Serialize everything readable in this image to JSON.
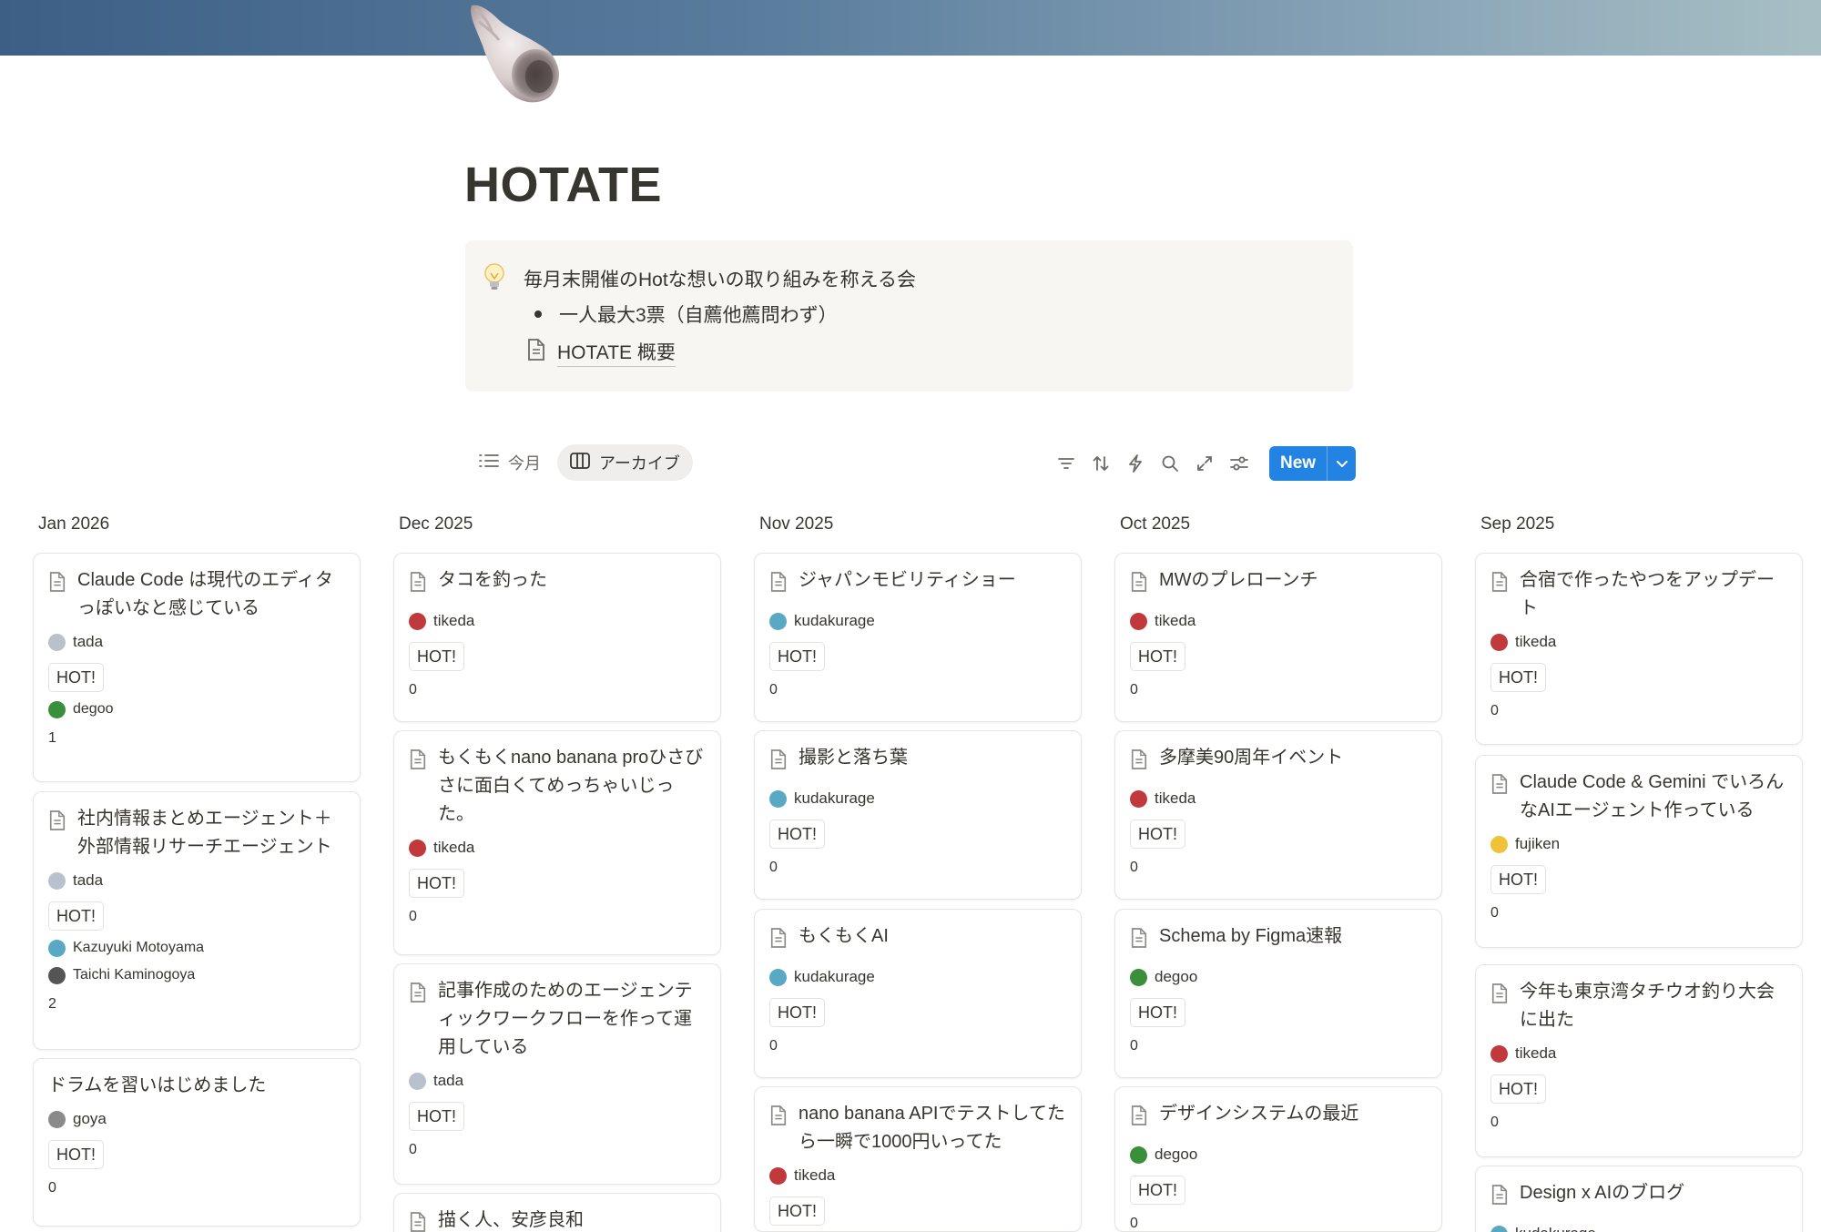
{
  "page": {
    "title": "HOTATE",
    "icon": "shell-icon"
  },
  "callout": {
    "icon": "lightbulb-icon",
    "text": "毎月末開催のHotな想いの取り組みを称える会",
    "bullet": "一人最大3票（自薦他薦問わず）",
    "link_icon": "page-icon",
    "link": "HOTATE 概要"
  },
  "views": [
    {
      "label": "今月",
      "icon": "list-icon",
      "active": false
    },
    {
      "label": "アーカイブ",
      "icon": "board-icon",
      "active": true
    }
  ],
  "toolbar": {
    "icons": [
      "filter-icon",
      "sort-icon",
      "automation-icon",
      "search-icon",
      "expand-icon",
      "settings-icon"
    ],
    "new_label": "New"
  },
  "columns": [
    {
      "title": "Jan 2026",
      "cards": [
        {
          "title": "Claude Code は現代のエディタっぽいなと感じている",
          "doc_icon": true,
          "author": "tada",
          "tag": "HOT!",
          "voters": [
            "degoo"
          ],
          "count": "1"
        },
        {
          "title": "社内情報まとめエージェント＋外部情報リサーチエージェント",
          "doc_icon": true,
          "author": "tada",
          "tag": "HOT!",
          "voters": [
            "Kazuyuki Motoyama",
            "Taichi Kaminogoya"
          ],
          "count": "2"
        },
        {
          "title": "ドラムを習いはじめました",
          "doc_icon": false,
          "author": "goya",
          "tag": "HOT!",
          "voters": [],
          "count": "0"
        }
      ]
    },
    {
      "title": "Dec 2025",
      "cards": [
        {
          "title": "タコを釣った",
          "doc_icon": true,
          "author": "tikeda",
          "tag": "HOT!",
          "voters": [],
          "count": "0"
        },
        {
          "title": "もくもくnano banana proひさびさに面白くてめっちゃいじった。",
          "doc_icon": true,
          "author": "tikeda",
          "tag": "HOT!",
          "voters": [],
          "count": "0"
        },
        {
          "title": "記事作成のためのエージェンティックワークフローを作って運用している",
          "doc_icon": true,
          "author": "tada",
          "tag": "HOT!",
          "voters": [],
          "count": "0"
        },
        {
          "title": "描く人、安彦良和",
          "doc_icon": true,
          "author": "",
          "tag": "",
          "voters": [],
          "count": ""
        }
      ]
    },
    {
      "title": "Nov 2025",
      "cards": [
        {
          "title": "ジャパンモビリティショー",
          "doc_icon": true,
          "author": "kudakurage",
          "tag": "HOT!",
          "voters": [],
          "count": "0"
        },
        {
          "title": "撮影と落ち葉",
          "doc_icon": true,
          "author": "kudakurage",
          "tag": "HOT!",
          "voters": [],
          "count": "0"
        },
        {
          "title": "もくもくAI",
          "doc_icon": true,
          "author": "kudakurage",
          "tag": "HOT!",
          "voters": [],
          "count": "0"
        },
        {
          "title": "nano banana APIでテストしてたら一瞬で1000円いってた",
          "doc_icon": true,
          "author": "tikeda",
          "tag": "HOT!",
          "voters": [],
          "count": ""
        }
      ]
    },
    {
      "title": "Oct 2025",
      "cards": [
        {
          "title": "MWのプレローンチ",
          "doc_icon": true,
          "author": "tikeda",
          "tag": "HOT!",
          "voters": [],
          "count": "0"
        },
        {
          "title": "多摩美90周年イベント",
          "doc_icon": true,
          "author": "tikeda",
          "tag": "HOT!",
          "voters": [],
          "count": "0"
        },
        {
          "title": "Schema by Figma速報",
          "doc_icon": true,
          "author": "degoo",
          "tag": "HOT!",
          "voters": [],
          "count": "0"
        },
        {
          "title": "デザインシステムの最近",
          "doc_icon": true,
          "author": "degoo",
          "tag": "HOT!",
          "voters": [],
          "count": "0"
        }
      ]
    },
    {
      "title": "Sep 2025",
      "cards": [
        {
          "title": "合宿で作ったやつをアップデート",
          "doc_icon": true,
          "author": "tikeda",
          "tag": "HOT!",
          "voters": [],
          "count": "0"
        },
        {
          "title": "Claude Code & Gemini でいろんなAIエージェント作っている",
          "doc_icon": true,
          "author": "fujiken",
          "tag": "HOT!",
          "voters": [],
          "count": "0"
        },
        {
          "title": "今年も東京湾タチウオ釣り大会に出た",
          "doc_icon": true,
          "author": "tikeda",
          "tag": "HOT!",
          "voters": [],
          "count": "0"
        },
        {
          "title": "Design x AIのブログ",
          "doc_icon": true,
          "author": "kudakurage",
          "tag": "",
          "voters": [],
          "count": ""
        }
      ]
    }
  ],
  "avatar_colors": {
    "tada": "#b9c2cc",
    "degoo": "#3a8f3a",
    "tikeda": "#c0393b",
    "kudakurage": "#5aa9c4",
    "goya": "#8a8a8a",
    "fujiken": "#f0c23a",
    "Kazuyuki Motoyama": "#5aa9c4",
    "Taichi Kaminogoya": "#555555"
  }
}
